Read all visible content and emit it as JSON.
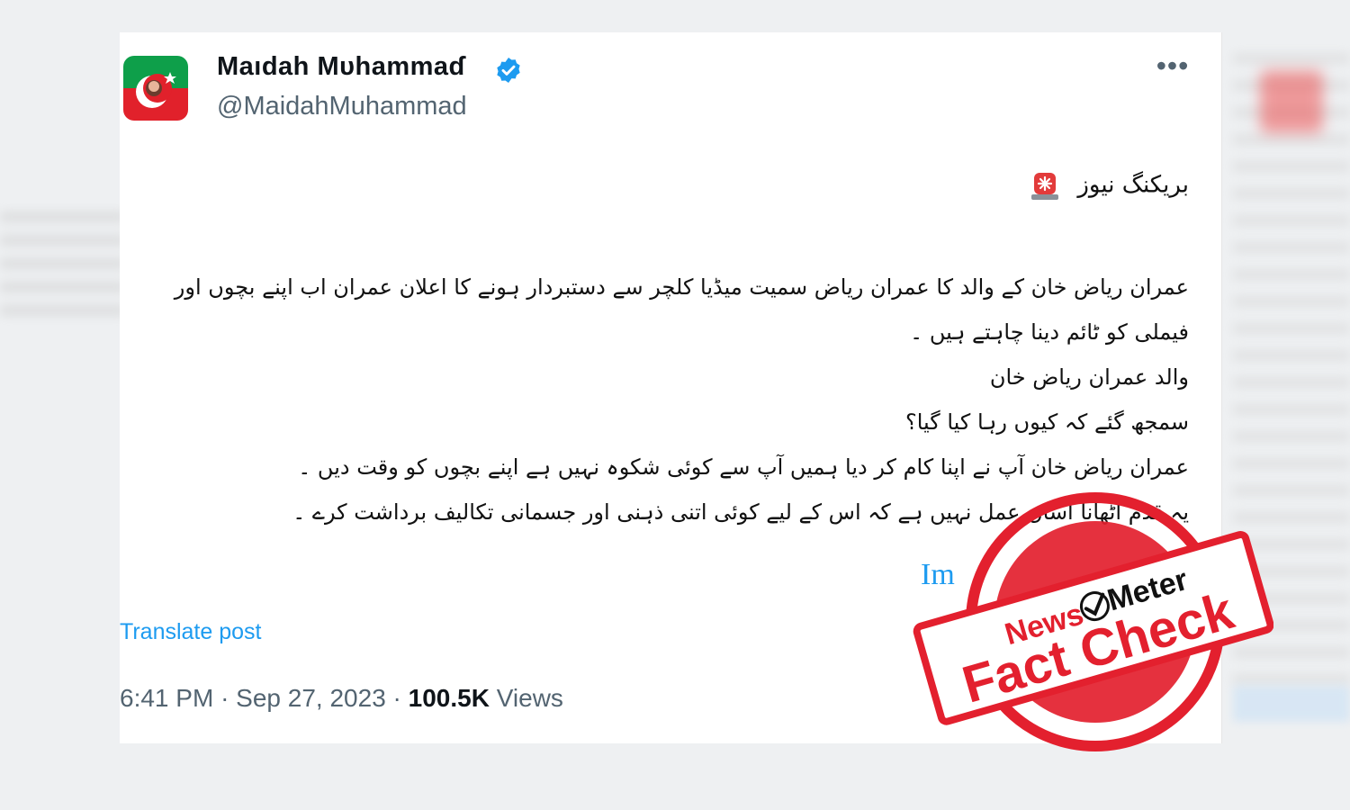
{
  "tweet": {
    "display_name": "Maıdah Mυhammaɗ",
    "handle": "@MaidahMuhammad",
    "verified": true,
    "more_icon": "more-horizontal-icon",
    "breaking_label": "بریکنگ نیوز",
    "siren_icon": "rotating-light-icon",
    "lines": [
      "عمران ریاض خان کے والد کا عمران ریاض سمیت میڈیا کلچر سے دستبردار ہونے کا اعلان عمران اب اپنے بچوں اور فیملی کو ٹائم دینا چاہتے ہیں ۔",
      "والد عمران ریاض خان",
      "سمجھ گئے کہ کیوں رہا کیا گیا؟",
      "عمران ریاض خان آپ نے اپنا کام کر دیا ہمیں آپ سے کوئی شکوہ نہیں ہے اپنے بچوں کو وقت دیں ۔",
      "یہ قدم اٹھانا آسان عمل نہیں ہے کہ اس کے لیے کوئی اتنی ذہنی اور جسمانی تکالیف برداشت کرے ۔"
    ],
    "link_fragment": "Im",
    "translate_label": "Translate post",
    "time": "6:41 PM",
    "date": "Sep 27, 2023",
    "views_count": "100.5K",
    "views_label": "Views"
  },
  "stamp": {
    "brand_news": "News",
    "brand_meter": "Meter",
    "label": "Fact Check",
    "color": "#e3202e"
  },
  "colors": {
    "accent": "#1d9bf0",
    "secondary_text": "#536471"
  }
}
